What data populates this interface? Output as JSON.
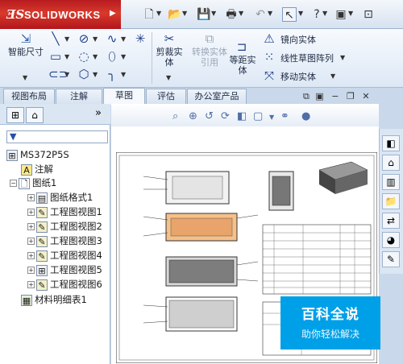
{
  "app": {
    "brand": "SOLIDWORKS",
    "ds_logo": "ƎS"
  },
  "ribbon": {
    "smart_dimension": "智能尺寸",
    "trim_entities": "剪裁实体",
    "convert_entities": "转换实体引用",
    "offset_entities": "等距实体",
    "mirror_entities": "镜向实体",
    "linear_pattern": "线性草图阵列",
    "move_entities": "移动实体"
  },
  "tabs": [
    {
      "label": "视图布局",
      "active": false
    },
    {
      "label": "注解",
      "active": false
    },
    {
      "label": "草图",
      "active": true
    },
    {
      "label": "评估",
      "active": false
    },
    {
      "label": "办公室产品",
      "active": false
    }
  ],
  "tree": {
    "root": "MS372P5S",
    "annotations": "注解",
    "sheet": "图纸1",
    "sheet_format": "图纸格式1",
    "views": [
      "工程图视图1",
      "工程图视图2",
      "工程图视图3",
      "工程图视图4",
      "工程图视图5",
      "工程图视图6"
    ],
    "bom": "材料明细表1"
  },
  "watermark": {
    "title": "百科全说",
    "subtitle": "助你轻松解决"
  },
  "colors": {
    "brand_red": "#c8231f",
    "ribbon_bg": "#e3ecf7",
    "watermark_blue": "#00a0e8"
  }
}
